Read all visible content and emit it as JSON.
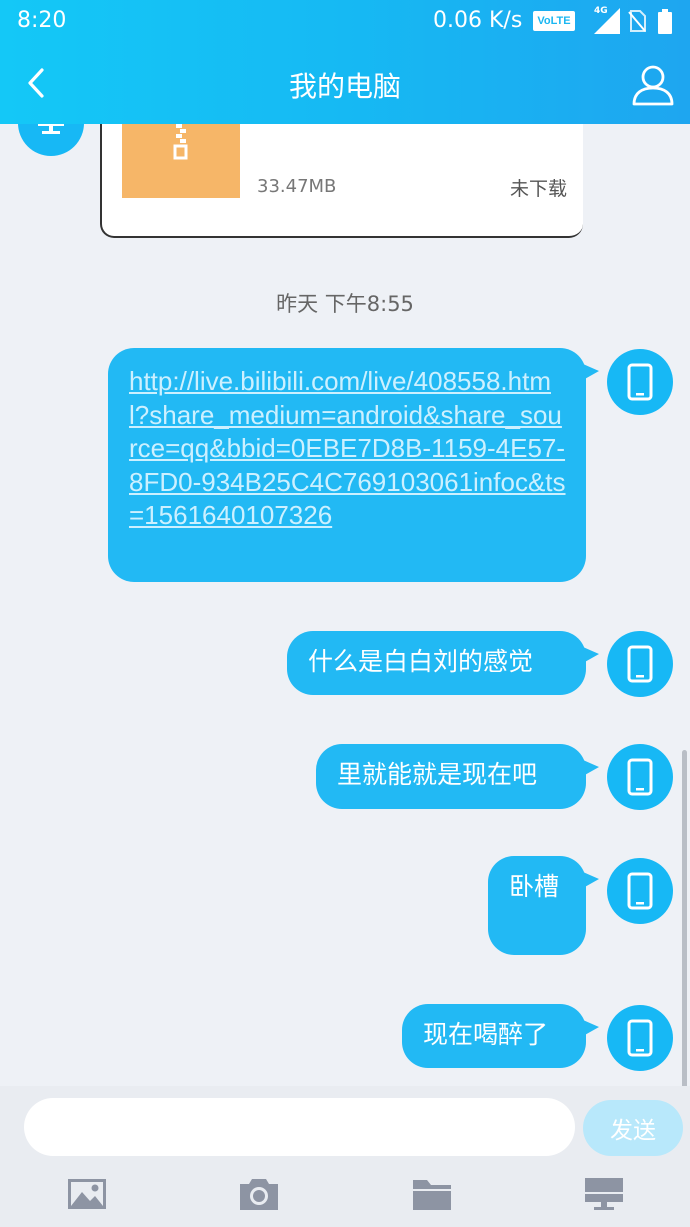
{
  "status_bar": {
    "time": "8:20",
    "network_speed": "0.06 K/s",
    "volte_label": "VoLTE",
    "signal_label": "4G",
    "icons": [
      "volte-icon",
      "signal-icon",
      "no-sim-icon",
      "battery-icon"
    ]
  },
  "header": {
    "title": "我的电脑",
    "back_icon": "chevron-left-icon",
    "profile_icon": "person-icon"
  },
  "file_message": {
    "size": "33.47MB",
    "status": "未下载",
    "thumb_color": "#f6b668"
  },
  "timestamp": "昨天 下午8:55",
  "messages": [
    {
      "type": "link",
      "text": "http://live.bilibili.com/live/408558.html?share_medium=android&share_source=qq&bbid=0EBE7D8B-1159-4E57-8FD0-934B25C4C769103061infoc&ts=1561640107326"
    },
    {
      "type": "text",
      "text": "什么是白白刘的感觉"
    },
    {
      "type": "text",
      "text": "里就能就是现在吧"
    },
    {
      "type": "text",
      "text": "卧槽"
    },
    {
      "type": "text",
      "text": "现在喝醉了"
    }
  ],
  "input": {
    "placeholder": "",
    "send_label": "发送"
  },
  "toolbar": [
    "image-icon",
    "camera-icon",
    "folder-icon",
    "computer-icon"
  ],
  "colors": {
    "header_start": "#14c8f7",
    "header_end": "#1ea6f0",
    "bubble": "#22b9f4",
    "background": "#eef1f6",
    "send_disabled": "#b8e8fb",
    "toolbar_icon": "#8d94a3"
  }
}
